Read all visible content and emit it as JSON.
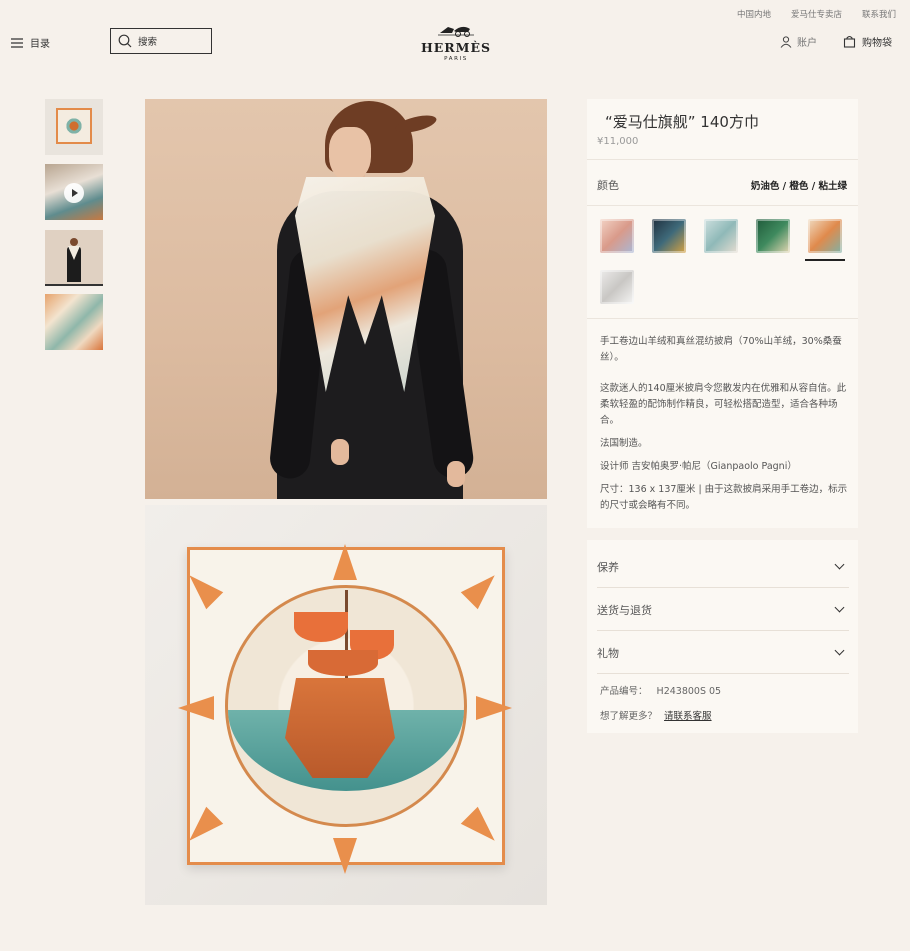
{
  "utility": {
    "region": "中国内地",
    "stores": "爱马仕专卖店",
    "contact": "联系我们"
  },
  "header": {
    "menu_label": "目录",
    "search_placeholder": "搜索",
    "brand": "HERMÈS",
    "brand_city": "PARIS",
    "account_label": "账户",
    "bag_label": "购物袋"
  },
  "product": {
    "title": "“爱马仕旗舰” 140方巾",
    "price": "¥11,000",
    "color_label": "颜色",
    "color_value": "奶油色 / 橙色 / 粘土绿",
    "swatches": [
      {
        "name": "swatch-1",
        "color": "#e7b8a6"
      },
      {
        "name": "swatch-2",
        "color": "#243748"
      },
      {
        "name": "swatch-3",
        "color": "#a9c7c6"
      },
      {
        "name": "swatch-4",
        "color": "#2f6b48"
      },
      {
        "name": "swatch-5",
        "color": "#e9c9a8"
      },
      {
        "name": "swatch-6",
        "color": "#d9d7d4"
      }
    ],
    "description": {
      "line1": "手工卷边山羊绒和真丝混纺披肩（70%山羊绒，30%桑蚕丝）。",
      "line2": "这款迷人的140厘米披肩令您散发内在优雅和从容自信。此柔软轻盈的配饰制作精良，可轻松搭配造型，适合各种场合。",
      "line3": "法国制造。",
      "line4": "设计师 吉安帕奥罗·帕尼（Gianpaolo Pagni）",
      "line5": "尺寸：136 x 137厘米 | 由于这款披肩采用手工卷边，标示的尺寸或会略有不同。"
    },
    "accordion": [
      "保养",
      "送货与退货",
      "礼物"
    ],
    "product_code_label": "产品编号：",
    "product_code": "H243800S 05",
    "more_info": "想了解更多？",
    "more_link": "请联系客服"
  },
  "colors": {
    "background": "#f6f1eb",
    "panel": "#fbf8f3",
    "accent_orange": "#e48c4b"
  }
}
